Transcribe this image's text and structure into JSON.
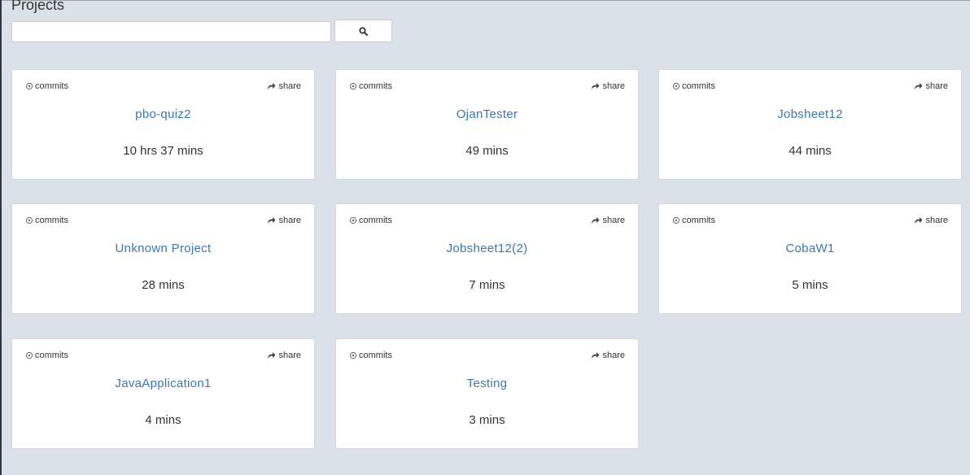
{
  "page": {
    "title": "Projects"
  },
  "search": {
    "placeholder": "",
    "value": "",
    "button_icon": "search-icon"
  },
  "card_labels": {
    "commits": "commits",
    "share": "share",
    "commits_icon": "code-fork-icon",
    "share_icon": "share-arrow-icon"
  },
  "projects": [
    {
      "name": "pbo-quiz2",
      "time": "10 hrs 37 mins"
    },
    {
      "name": "OjanTester",
      "time": "49 mins"
    },
    {
      "name": "Jobsheet12",
      "time": "44 mins"
    },
    {
      "name": "Unknown Project",
      "time": "28 mins"
    },
    {
      "name": "Jobsheet12(2)",
      "time": "7 mins"
    },
    {
      "name": "CobaW1",
      "time": "5 mins"
    },
    {
      "name": "JavaApplication1",
      "time": "4 mins"
    },
    {
      "name": "Testing",
      "time": "3 mins"
    }
  ],
  "colors": {
    "background": "#dbe1e8",
    "link": "#3a78b0",
    "text": "#333333",
    "card": "#ffffff"
  }
}
